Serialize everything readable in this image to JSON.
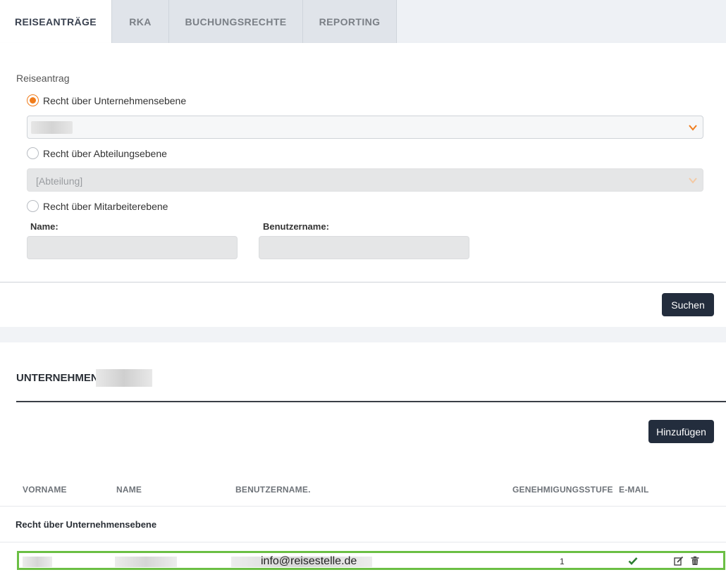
{
  "tabs": [
    {
      "label": "REISEANTRÄGE",
      "active": true
    },
    {
      "label": "RKA",
      "active": false
    },
    {
      "label": "BUCHUNGSRECHTE",
      "active": false
    },
    {
      "label": "REPORTING",
      "active": false
    }
  ],
  "form": {
    "section_label": "Reiseantrag",
    "radio_company": "Recht über Unternehmensebene",
    "radio_department": "Recht über Abteilungsebene",
    "radio_employee": "Recht über Mitarbeiterebene",
    "department_placeholder": "[Abteilung]",
    "name_label": "Name:",
    "username_label": "Benutzername:",
    "search_button": "Suchen"
  },
  "results": {
    "company_title": "UNTERNEHMEN",
    "add_button": "Hinzufügen",
    "columns": [
      "VORNAME",
      "NAME",
      "BENUTZERNAME.",
      "GENEHMIGUNGSSTUFE",
      "E-MAIL"
    ],
    "group_title": "Recht über Unternehmensebene",
    "rows": [
      {
        "email": "info@reisestelle.de",
        "level": "1"
      }
    ]
  },
  "colors": {
    "accent": "#f07c1b",
    "button": "#232d3d",
    "highlight": "#6bbf44",
    "check": "#2e7d32"
  }
}
